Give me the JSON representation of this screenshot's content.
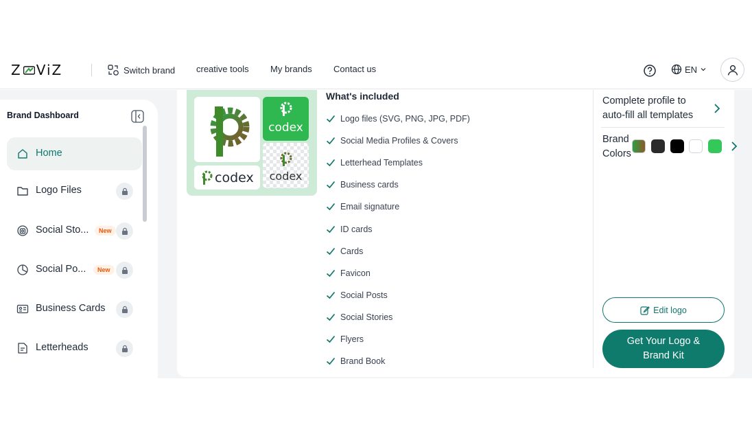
{
  "header": {
    "logo_text_left": "Z",
    "logo_text_right": "ViZ",
    "nav": {
      "switch_brand": "Switch brand",
      "creative_tools": "creative tools",
      "my_brands": "My brands",
      "contact_us": "Contact us"
    },
    "language": "EN"
  },
  "sidebar": {
    "title": "Brand Dashboard",
    "items": [
      {
        "label": "Home",
        "icon": "home-icon",
        "active": true
      },
      {
        "label": "Logo Files",
        "icon": "folder-icon",
        "locked": true
      },
      {
        "label": "Social Sto...",
        "icon": "story-icon",
        "badge": "New",
        "locked": true
      },
      {
        "label": "Social Po...",
        "icon": "post-icon",
        "badge": "New",
        "locked": true
      },
      {
        "label": "Business Cards",
        "icon": "card-icon",
        "locked": true
      },
      {
        "label": "Letterheads",
        "icon": "letterhead-icon",
        "locked": true
      }
    ]
  },
  "preview": {
    "brand_name": "codex"
  },
  "included": {
    "title": "What's included",
    "items": [
      "Logo files (SVG, PNG, JPG, PDF)",
      "Social Media Profiles & Covers",
      "Letterhead Templates",
      "Business cards",
      "Email signature",
      "ID cards",
      "Cards",
      "Favicon",
      "Social Posts",
      "Social Stories",
      "Flyers",
      "Brand Book"
    ]
  },
  "right_panel": {
    "complete_profile": "Complete profile to auto-fill all templates",
    "brand_colors_label": "Brand Colors",
    "brand_colors": [
      "gradient",
      "#2b2b2b",
      "#000000",
      "#ffffff",
      "#34c759"
    ],
    "edit_logo": "Edit logo",
    "get_kit": "Get Your Logo & Brand Kit"
  },
  "colors": {
    "accent": "#0f766e",
    "brand_green": "#34c759",
    "logo_green": "#3f8b2c"
  }
}
